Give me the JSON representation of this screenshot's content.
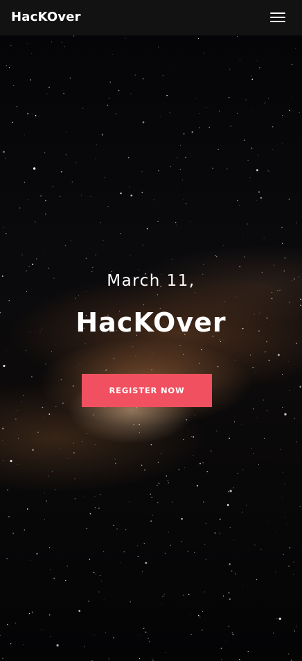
{
  "navbar": {
    "brand": "HacKOver",
    "menu_icon": "hamburger-menu-icon"
  },
  "hero": {
    "date": "March 11,",
    "title": "HacKOver",
    "register_label": "REGISTER NOW"
  },
  "colors": {
    "navbar_bg": "#121212",
    "accent": "#f0505f",
    "text": "#ffffff"
  }
}
